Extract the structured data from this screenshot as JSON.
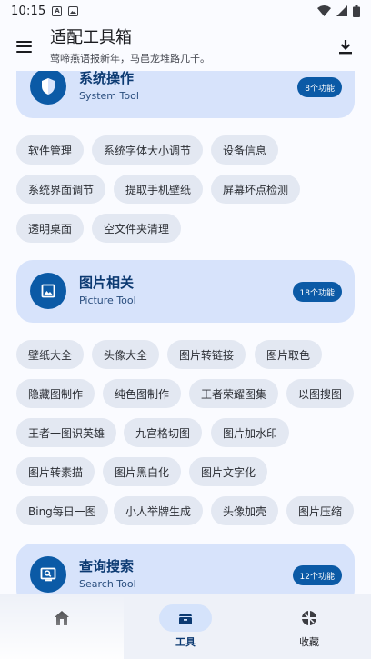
{
  "status_bar": {
    "time": "10:15",
    "notification_icons": [
      "a-notification-icon",
      "image-notification-icon"
    ],
    "right_icons": [
      "wifi-icon",
      "signal-icon",
      "battery-icon"
    ]
  },
  "app_bar": {
    "title": "适配工具箱",
    "subtitle": "莺啼燕语报新年，马邑龙堆路几千。",
    "menu_icon": "hamburger-menu-icon",
    "action_icon": "download-icon"
  },
  "sections": [
    {
      "title": "系统操作",
      "subtitle": "System Tool",
      "badge": "8个功能",
      "icon": "shield-icon",
      "tools": [
        "软件管理",
        "系统字体大小调节",
        "设备信息",
        "系统界面调节",
        "提取手机壁纸",
        "屏幕坏点检测",
        "透明桌面",
        "空文件夹清理"
      ]
    },
    {
      "title": "图片相关",
      "subtitle": "Picture Tool",
      "badge": "18个功能",
      "icon": "image-icon",
      "tools": [
        "壁纸大全",
        "头像大全",
        "图片转链接",
        "图片取色",
        "隐藏图制作",
        "纯色图制作",
        "王者荣耀图集",
        "以图搜图",
        "王者一图识英雄",
        "九宫格切图",
        "图片加水印",
        "图片转素描",
        "图片黑白化",
        "图片文字化",
        "Bing每日一图",
        "小人举牌生成",
        "头像加壳",
        "图片压缩"
      ]
    },
    {
      "title": "查询搜索",
      "subtitle": "Search Tool",
      "badge": "12个功能",
      "icon": "search-screen-icon",
      "tools": []
    }
  ],
  "bottom_nav": {
    "items": [
      {
        "label": "",
        "icon": "home-icon",
        "active": false
      },
      {
        "label": "工具",
        "icon": "toolbox-icon",
        "active": true
      },
      {
        "label": "收藏",
        "icon": "collection-icon",
        "active": false
      }
    ]
  },
  "colors": {
    "background": "#fafbff",
    "card": "#d7e3fb",
    "accent": "#0b5aa6",
    "chip": "#e3e8f2",
    "nav": "#eef1f8"
  }
}
